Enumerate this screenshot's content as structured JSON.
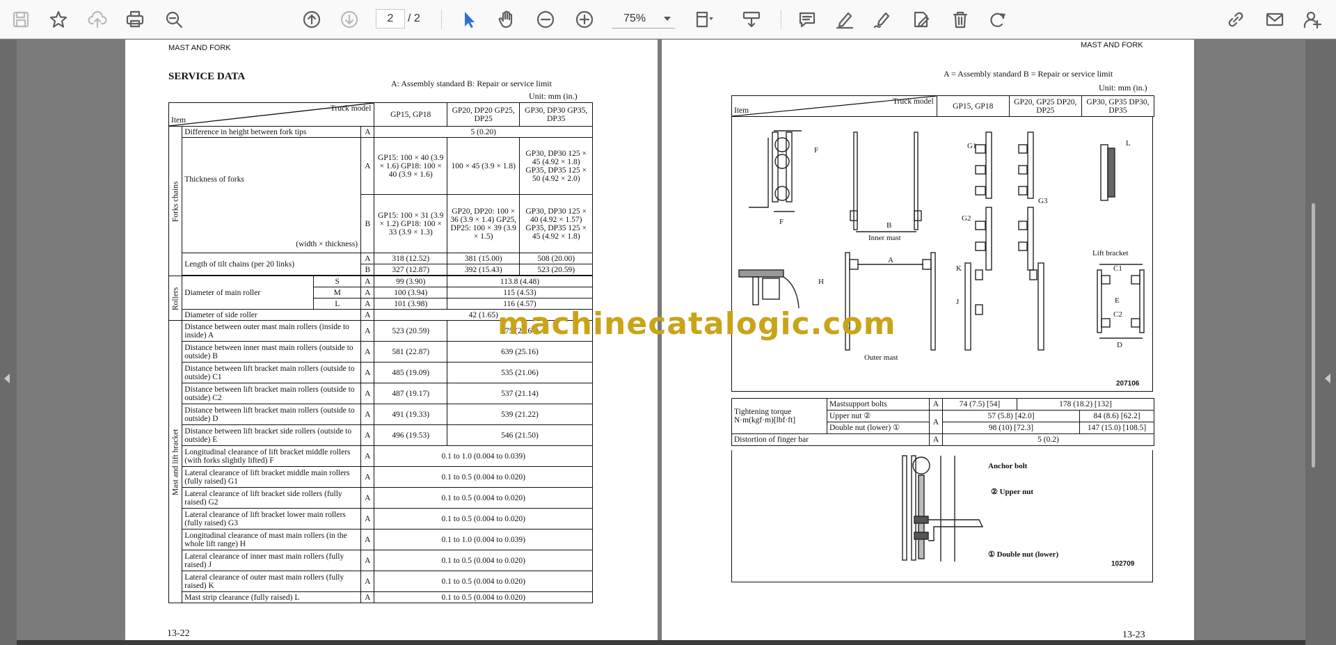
{
  "toolbar": {
    "page_current": "2",
    "page_total": "/ 2",
    "zoom": "75%"
  },
  "left_page": {
    "header": "MAST AND FORK",
    "title": "SERVICE DATA",
    "legend": "A: Assembly standard   B: Repair or service limit",
    "unit": "Unit: mm (in.)",
    "col_truck_model": "Truck model",
    "col_item": "Item",
    "col_gp15": "GP15, GP18",
    "col_gp20": "GP20, DP20 GP25, DP25",
    "col_gp30": "GP30, DP30 GP35, DP35",
    "group_forks": "Forks chains",
    "group_rollers": "Rollers",
    "group_mast": "Mast and lift bracket",
    "rows": {
      "r1_item": "Difference in height between fork tips",
      "r1_ab": "A",
      "r1_v": "5 (0.20)",
      "r2_item": "Thickness of forks",
      "r2_item2": "(width × thickness)",
      "r2a_ab": "A",
      "r2a_v1": "GP15: 100 × 40 (3.9 × 1.6) GP18: 100 × 40 (3.9 × 1.6)",
      "r2a_v2": "100 × 45 (3.9 × 1.8)",
      "r2a_v3": "GP30, DP30 125 × 45 (4.92 × 1.8) GP35, DP35 125 × 50 (4.92 × 2.0)",
      "r2b_ab": "B",
      "r2b_v1": "GP15: 100 × 31 (3.9 × 1.2) GP18: 100 × 33 (3.9 × 1.3)",
      "r2b_v2": "GP20, DP20: 100 × 36 (3.9 × 1.4) GP25, DP25: 100 × 39 (3.9 × 1.5)",
      "r2b_v3": "GP30, DP30 125 × 40 (4.92 × 1.57) GP35, DP35 125 × 45 (4.92 × 1.8)",
      "r3_item": "Length of tilt chains (per 20 links)",
      "r3a_ab": "A",
      "r3a_v1": "318 (12.52)",
      "r3a_v2": "381 (15.00)",
      "r3a_v3": "508 (20.00)",
      "r3b_ab": "B",
      "r3b_v1": "327 (12.87)",
      "r3b_v2": "392 (15.43)",
      "r3b_v3": "523 (20.59)",
      "r4_item": "Diameter of main roller",
      "r4s_size": "S",
      "r4s_ab": "A",
      "r4s_v1": "99 (3.90)",
      "r4s_v2": "113.8 (4.48)",
      "r4m_size": "M",
      "r4m_ab": "A",
      "r4m_v1": "100 (3.94)",
      "r4m_v2": "115 (4.53)",
      "r4l_size": "L",
      "r4l_ab": "A",
      "r4l_v1": "101 (3.98)",
      "r4l_v2": "116 (4.57)",
      "r5_item": "Diameter of side roller",
      "r5_ab": "A",
      "r5_v": "42 (1.65)",
      "r6_item": "Distance between outer mast main rollers (inside to inside) A",
      "r6_ab": "A",
      "r6_v1": "523 (20.59)",
      "r6_v2": "575 (22.64)",
      "r7_item": "Distance between inner mast main rollers (outside to outside) B",
      "r7_ab": "A",
      "r7_v1": "581 (22.87)",
      "r7_v2": "639 (25.16)",
      "r8_item": "Distance between lift bracket main rollers (outside to outside) C1",
      "r8_ab": "A",
      "r8_v1": "485 (19.09)",
      "r8_v2": "535 (21.06)",
      "r9_item": "Distance between lift bracket main rollers (outside to outside) C2",
      "r9_ab": "A",
      "r9_v1": "487 (19.17)",
      "r9_v2": "537 (21.14)",
      "r10_item": "Distance between lift bracket main rollers (outside to outside) D",
      "r10_ab": "A",
      "r10_v1": "491 (19.33)",
      "r10_v2": "539 (21.22)",
      "r11_item": "Distance between lift bracket side rollers (outside to outside) E",
      "r11_ab": "A",
      "r11_v1": "496 (19.53)",
      "r11_v2": "546 (21.50)",
      "r12_item": "Longitudinal clearance of lift bracket middle rollers (with forks slightly lifted) F",
      "r12_ab": "A",
      "r12_v": "0.1 to 1.0 (0.004 to 0.039)",
      "r13_item": "Lateral clearance of lift bracket middle main rollers (fully raised) G1",
      "r13_ab": "A",
      "r13_v": "0.1 to 0.5 (0.004 to 0.020)",
      "r14_item": "Lateral clearance of lift bracket side rollers (fully raised) G2",
      "r14_ab": "A",
      "r14_v": "0.1 to 0.5 (0.004 to 0.020)",
      "r15_item": "Lateral clearance of lift bracket lower main rollers (fully raised) G3",
      "r15_ab": "A",
      "r15_v": "0.1 to 0.5 (0.004 to 0.020)",
      "r16_item": "Longitudinal clearance of mast main rollers (in the whole lift range) H",
      "r16_ab": "A",
      "r16_v": "0.1 to 1.0 (0.004 to 0.039)",
      "r17_item": "Lateral clearance of inner mast main rollers (fully raised) J",
      "r17_ab": "A",
      "r17_v": "0.1 to 0.5 (0.004 to 0.020)",
      "r18_item": "Lateral clearance of outer mast main rollers (fully raised) K",
      "r18_ab": "A",
      "r18_v": "0.1 to 0.5 (0.004 to 0.020)",
      "r19_item": "Mast strip clearance (fully raised) L",
      "r19_ab": "A",
      "r19_v": "0.1 to 0.5 (0.004 to 0.020)"
    },
    "page_number": "13-22"
  },
  "right_page": {
    "header": "MAST AND FORK",
    "legend": "A = Assembly standard   B = Repair or service limit",
    "unit": "Unit: mm (in.)",
    "col_truck_model": "Truck model",
    "col_item": "Item",
    "col_gp15": "GP15, GP18",
    "col_gp20": "GP20, GP25 DP20, DP25",
    "col_gp30": "GP30, GP35 DP30, DP35",
    "diag_labels": {
      "f": "F",
      "b": "B",
      "inner_mast": "Inner mast",
      "g1": "G1",
      "g3": "G3",
      "l": "L",
      "g2": "G2",
      "lift_bracket": "Lift bracket",
      "c1": "C1",
      "e": "E",
      "c2": "C2",
      "d": "D",
      "k": "K",
      "j": "J",
      "a": "A",
      "h": "H",
      "outer_mast": "Outer mast",
      "code": "207106"
    },
    "torque_label": "Tightening torque N·m(kgf·m)[lbf·ft]",
    "torque_rows": {
      "t1_name": "Mastsupport bolts",
      "t1_ab": "A",
      "t1_v1": "74 (7.5) [54]",
      "t1_v2": "178 (18.2) [132]",
      "t2_name": "Upper nut ②",
      "t2_v1": "57 (5.8) [42.0]",
      "t2_v2": "84 (8.6) [62.2]",
      "t3_name": "Double nut (lower) ①",
      "t23_ab": "A",
      "t3_v1": "98 (10) [72.3]",
      "t3_v2": "147 (15.0) [108.5]"
    },
    "dist_label": "Distortion of finger bar",
    "dist_ab": "A",
    "dist_v": "5 (0.2)",
    "bolt_labels": {
      "anchor": "Anchor bolt",
      "upper": "② Upper nut",
      "double": "① Double nut (lower)",
      "code": "102709"
    },
    "page_number": "13-23"
  },
  "watermark": "machinecatalogic.com"
}
